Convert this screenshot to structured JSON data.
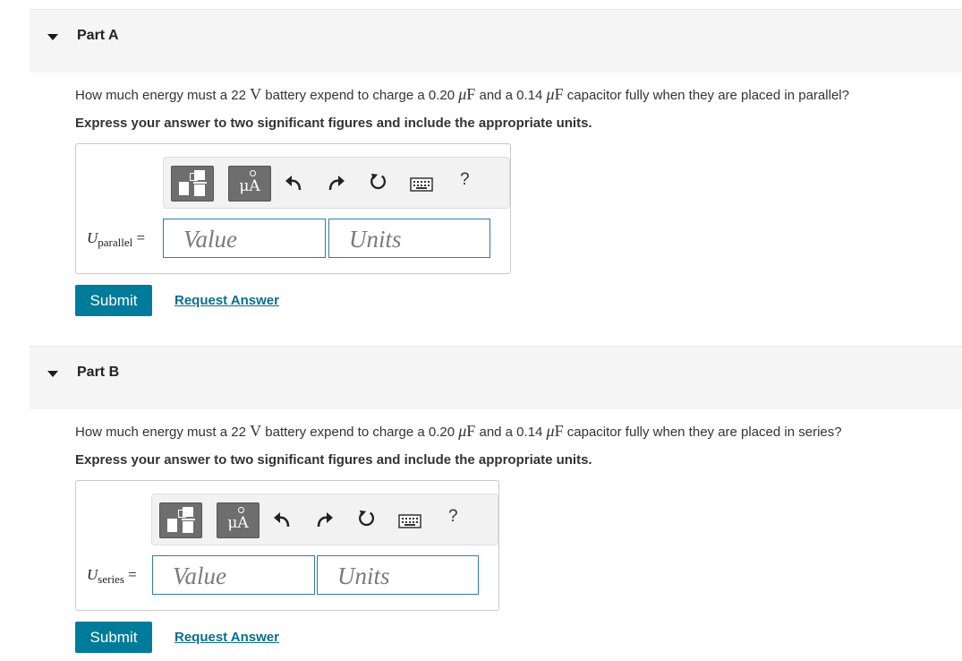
{
  "parts": [
    {
      "title": "Part A",
      "question": {
        "p1": "How much energy must a 22 ",
        "v": "V",
        "p2": " battery expend to charge a 0.20 ",
        "mu1": "μ",
        "f1": "F",
        "p3": " and a 0.14 ",
        "mu2": "μ",
        "f2": "F",
        "p4": " capacitor fully when they are placed in parallel?"
      },
      "instruction": "Express your answer to two significant figures and include the appropriate units.",
      "toolbar": {
        "units_label": "μA",
        "units_ring": "",
        "help": "?"
      },
      "variable": {
        "symbol": "U",
        "subscript": "parallel",
        "equals": " ="
      },
      "value_placeholder": "Value",
      "units_placeholder": "Units",
      "submit_label": "Submit",
      "request_label": "Request Answer"
    },
    {
      "title": "Part B",
      "question": {
        "p1": "How much energy must a 22 ",
        "v": "V",
        "p2": " battery expend to charge a 0.20 ",
        "mu1": "μ",
        "f1": "F",
        "p3": " and a 0.14 ",
        "mu2": "μ",
        "f2": "F",
        "p4": " capacitor fully when they are placed in series?"
      },
      "instruction": "Express your answer to two significant figures and include the appropriate units.",
      "toolbar": {
        "units_label": "μA",
        "units_ring": "",
        "help": "?"
      },
      "variable": {
        "symbol": "U",
        "subscript": "series",
        "equals": " ="
      },
      "value_placeholder": "Value",
      "units_placeholder": "Units",
      "submit_label": "Submit",
      "request_label": "Request Answer"
    }
  ],
  "icons": [
    "caret-down-icon",
    "templates-icon",
    "units-icon",
    "undo-icon",
    "redo-icon",
    "reset-icon",
    "keyboard-icon",
    "help-icon"
  ]
}
